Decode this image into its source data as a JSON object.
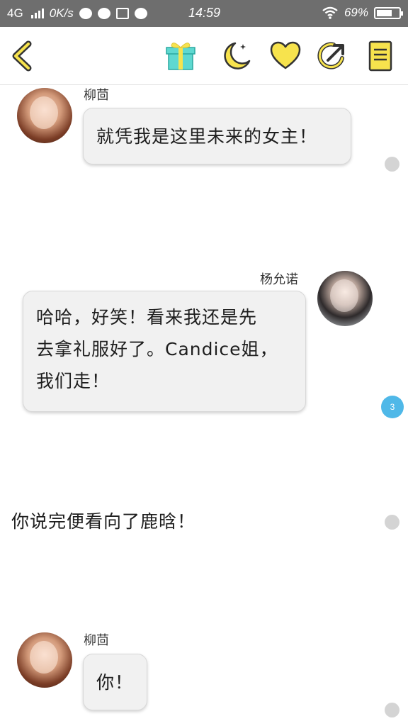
{
  "status_bar": {
    "network": "4G",
    "speed": "0K/s",
    "time": "14:59",
    "battery": "69%",
    "battery_level": 0.69
  },
  "toolbar": {
    "icons": [
      "back-chevron-icon",
      "gift-icon",
      "moon-icon",
      "heart-icon",
      "share-icon",
      "book-icon"
    ],
    "accent_color": "#f7e34d"
  },
  "chat": {
    "messages": [
      {
        "speaker": "柳茴",
        "text": "就凭我是这里未来的女主！"
      },
      {
        "speaker": "杨允诺",
        "lines": [
          "哈哈，好笑！看来我还是先",
          "去拿礼服好了。Candice姐，",
          "我们走！"
        ],
        "comment_count": "3"
      },
      {
        "narration": "你说完便看向了鹿晗！"
      },
      {
        "speaker": "柳茴",
        "text": "你！"
      }
    ]
  }
}
